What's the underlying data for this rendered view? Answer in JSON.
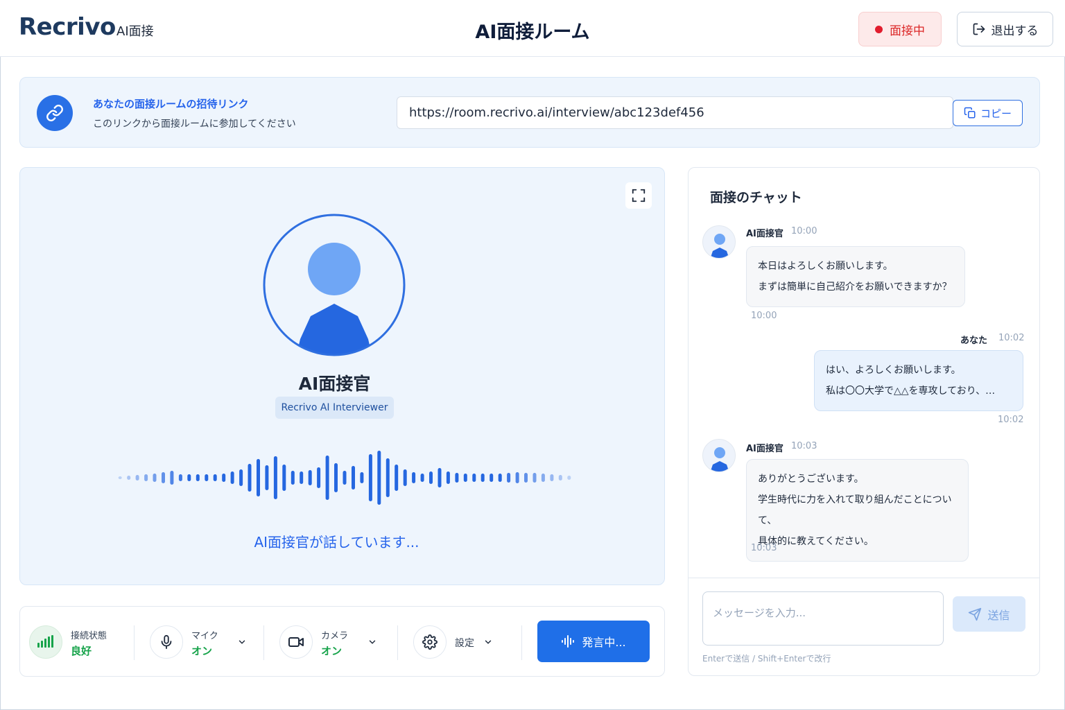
{
  "header": {
    "logo": "Recrivo",
    "logo_sub": "AI面接",
    "title": "AI面接ルーム",
    "status": "面接中",
    "exit_label": "退出する"
  },
  "invite": {
    "title": "あなたの面接ルームの招待リンク",
    "description": "このリンクから面接ルームに参加してください",
    "url": "https://room.recrivo.ai/interview/abc123def456",
    "copy_label": "コピー"
  },
  "video": {
    "name": "AI面接官",
    "tag": "Recrivo AI Interviewer",
    "speaking": "AI面接官が話しています..."
  },
  "controls": {
    "connection": {
      "label": "接続状態",
      "value": "良好"
    },
    "mic": {
      "label": "マイク",
      "value": "オン"
    },
    "camera": {
      "label": "カメラ",
      "value": "オン"
    },
    "settings": {
      "label": "設定"
    },
    "speak_label": "発言中..."
  },
  "chat": {
    "title": "面接のチャット",
    "messages": [
      {
        "sender": "AI面接官",
        "time": "10:00",
        "lines": [
          "本日はよろしくお願いします。",
          "まずは簡単に自己紹介をお願いできますか？"
        ],
        "footer_time": "10:00"
      },
      {
        "sender": "あなた",
        "time": "10:02",
        "lines": [
          "はい、よろしくお願いします。",
          "私は〇〇大学で△△を専攻しており、…"
        ],
        "footer_time": "10:02"
      },
      {
        "sender": "AI面接官",
        "time": "10:03",
        "lines": [
          "ありがとうございます。",
          "学生時代に力を入れて取り組んだことについて、",
          "具体的に教えてください。"
        ],
        "footer_time": "10:03"
      }
    ],
    "input_placeholder": "メッセージを入力...",
    "send_label": "送信",
    "hint": "Enterで送信 / Shift+Enterで改行"
  },
  "colors": {
    "accent": "#1f6fe8",
    "live": "#e11d2e",
    "good": "#16a34a"
  },
  "icons": [
    "link-icon",
    "copy-icon",
    "exit-icon",
    "expand-icon",
    "signal-icon",
    "mic-icon",
    "camera-icon",
    "gear-icon",
    "chevron-down-icon",
    "waveform-icon",
    "send-icon"
  ]
}
